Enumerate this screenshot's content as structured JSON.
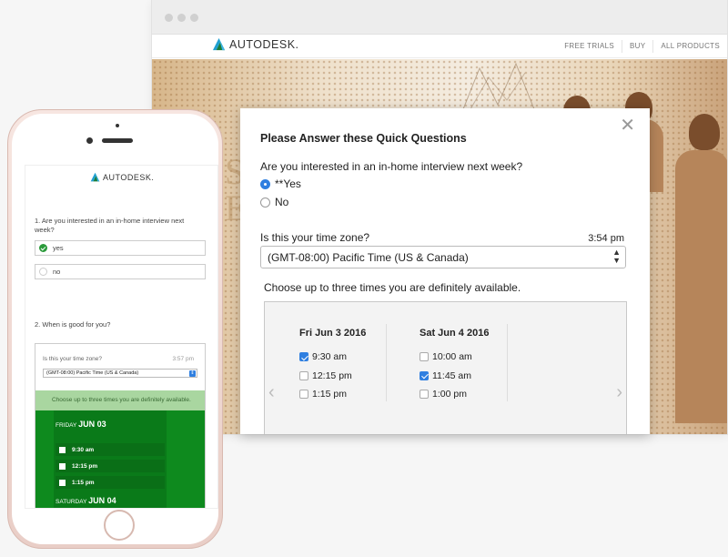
{
  "desktop": {
    "brand": "AUTODESK.",
    "nav": [
      "FREE TRIALS",
      "BUY",
      "ALL PRODUCTS"
    ]
  },
  "modal": {
    "title": "Please Answer these Quick Questions",
    "question1": "Are you interested in an in-home interview next week?",
    "options": [
      {
        "label": "**Yes",
        "selected": true
      },
      {
        "label": "No",
        "selected": false
      }
    ],
    "tz_label": "Is this your time zone?",
    "tz_time": "3:54 pm",
    "tz_value": "(GMT-08:00) Pacific Time (US & Canada)",
    "choose_text": "Choose up to three times you are definitely available.",
    "days": [
      {
        "label": "Fri Jun 3 2016",
        "slots": [
          {
            "time": "9:30 am",
            "checked": true
          },
          {
            "time": "12:15 pm",
            "checked": false
          },
          {
            "time": "1:15 pm",
            "checked": false
          }
        ]
      },
      {
        "label": "Sat Jun 4 2016",
        "slots": [
          {
            "time": "10:00 am",
            "checked": false
          },
          {
            "time": "11:45 am",
            "checked": true
          },
          {
            "time": "1:00 pm",
            "checked": false
          }
        ]
      }
    ]
  },
  "mobile": {
    "brand": "AUTODESK.",
    "question1": "1.  Are you interested in an in-home interview next week?",
    "options": [
      {
        "label": "yes",
        "selected": true
      },
      {
        "label": "no",
        "selected": false
      }
    ],
    "question2": "2.  When is good for you?",
    "tz_label": "Is this your time zone?",
    "tz_time": "3:57 pm",
    "tz_value": "(GMT-08:00) Pacific Time (US & Canada)",
    "choose_text": "Choose up to three times you are definitely available.",
    "day1_prefix": "FRIDAY",
    "day1_date": "JUN 03",
    "slots": [
      "9:30 am",
      "12:15 pm",
      "1:15 pm"
    ],
    "day2_prefix": "SATURDAY",
    "day2_date": "JUN 04"
  },
  "colors": {
    "accent_blue": "#2f7fe0",
    "mobile_green": "#0e8a1e",
    "mobile_green_light": "#a9d6a0"
  }
}
